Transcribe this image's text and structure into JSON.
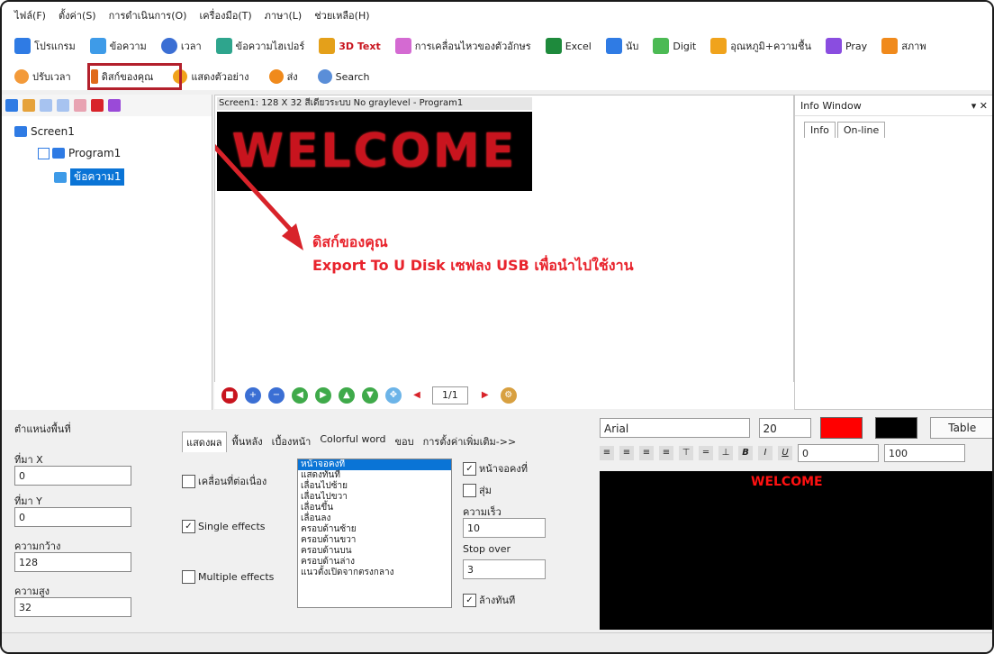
{
  "menu": [
    "ไฟล์(F)",
    "ตั้งค่า(S)",
    "การดำเนินการ(O)",
    "เครื่องมือ(T)",
    "ภาษา(L)",
    "ช่วยเหลือ(H)"
  ],
  "toolbar1": [
    {
      "label": "โปรแกรม",
      "color": "#2f7be4"
    },
    {
      "label": "ข้อความ",
      "color": "#3e9be8"
    },
    {
      "label": "เวลา",
      "color": "#3b6fd4"
    },
    {
      "label": "ข้อความไฮเปอร์",
      "color": "#2ea58d"
    },
    {
      "label": "3D Text",
      "color": "#e4a01a"
    },
    {
      "label": "การเคลื่อนไหวของตัวอักษร",
      "color": "#d46ad2"
    },
    {
      "label": "Excel",
      "color": "#1e8a3c"
    },
    {
      "label": "นับ",
      "color": "#2f7be4"
    },
    {
      "label": "Digit",
      "color": "#4cba54"
    },
    {
      "label": "อุณหภูมิ+ความชื้น",
      "color": "#f0a31c"
    },
    {
      "label": "Pray",
      "color": "#8a4de0"
    },
    {
      "label": "สภาพ",
      "color": "#f08a1c"
    }
  ],
  "toolbar2": [
    {
      "label": "ปรับเวลา",
      "color": "#f39a3a"
    },
    {
      "label": "ดิสก์ของคุณ",
      "color": "#e06a1a"
    },
    {
      "label": "แสดงตัวอย่าง",
      "color": "#f0a31c"
    },
    {
      "label": "ส่ง",
      "color": "#f08a1c"
    },
    {
      "label": "Search",
      "color": "#5a8ed8"
    }
  ],
  "tree": {
    "screen": "Screen1",
    "program": "Program1",
    "item": "ข้อความ1"
  },
  "center": {
    "title": "Screen1: 128 X 32  สีเดียวระบบ  No graylevel - Program1",
    "led_text": "WELCOME"
  },
  "annotation": {
    "line1": "ดิสก์ของคุณ",
    "line2": "Export To U Disk เซฟลง USB เพื่อนำไปใช้งาน"
  },
  "nav": {
    "page": "1/1"
  },
  "info": {
    "title": "Info Window",
    "tabs": [
      "Info",
      "On-line"
    ]
  },
  "props": {
    "header": "ตำแหน่งพื้นที่",
    "x_label": "ที่มา X",
    "x": "0",
    "y_label": "ที่มา Y",
    "y": "0",
    "w_label": "ความกว้าง",
    "w": "128",
    "h_label": "ความสูง",
    "h": "32"
  },
  "effects": {
    "tabs": [
      "แสดงผล",
      "พื้นหลัง",
      "เบื้องหน้า",
      "Colorful word",
      "ขอบ",
      "การตั้งค่าเพิ่มเติม->>"
    ],
    "chk1": "เคลื่อนที่ต่อเนื่อง",
    "chk2": "Single effects",
    "chk3": "Multiple effects",
    "list": [
      "หน้าจอคงที่",
      "แสดงทันที",
      "เลื่อนไปซ้าย",
      "เลื่อนไปขวา",
      "เลื่อนขึ้น",
      "เลื่อนลง",
      "ครอบด้านซ้าย",
      "ครอบด้านขวา",
      "ครอบด้านบน",
      "ครอบด้านล่าง",
      "แนวตั้งเปิดจากตรงกลาง"
    ],
    "static_label": "หน้าจอคงที่",
    "random_label": "สุ่ม",
    "speed_label": "ความเร็ว",
    "speed": "10",
    "stop_label": "Stop over",
    "stop": "3",
    "clear_label": "ล้างทันที"
  },
  "editor": {
    "font": "Arial",
    "size": "20",
    "fg": "#ff0000",
    "bg": "#000000",
    "table": "Table",
    "spacing": "0",
    "zoom": "100",
    "text": "WELCOME"
  }
}
